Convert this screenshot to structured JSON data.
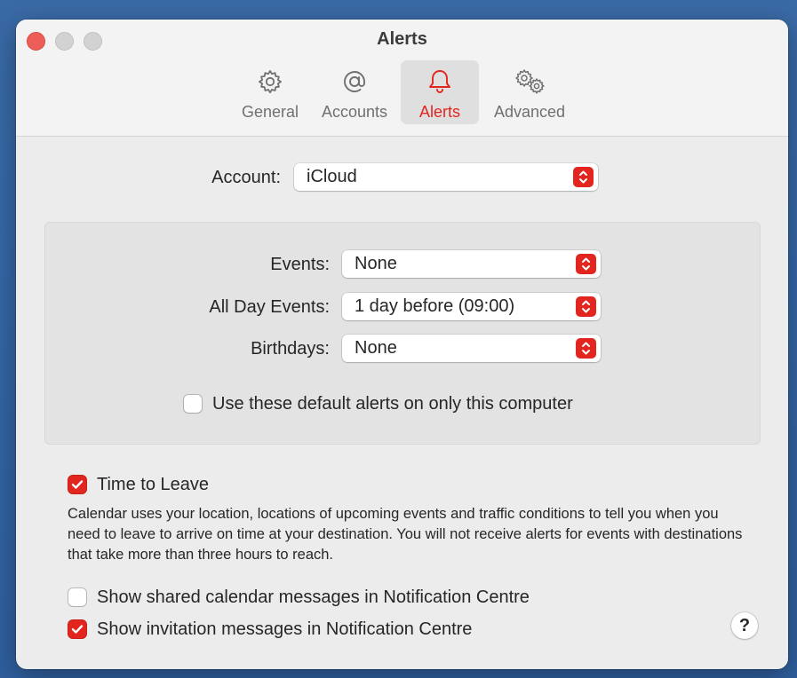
{
  "window": {
    "title": "Alerts"
  },
  "toolbar": {
    "tabs": [
      {
        "label": "General",
        "icon": "gear-icon"
      },
      {
        "label": "Accounts",
        "icon": "at-icon"
      },
      {
        "label": "Alerts",
        "icon": "bell-icon",
        "selected": true
      },
      {
        "label": "Advanced",
        "icon": "gears-icon"
      }
    ]
  },
  "account": {
    "label": "Account:",
    "value": "iCloud"
  },
  "defaults": {
    "events": {
      "label": "Events:",
      "value": "None"
    },
    "all_day_events": {
      "label": "All Day Events:",
      "value": "1 day before (09:00)"
    },
    "birthdays": {
      "label": "Birthdays:",
      "value": "None"
    },
    "only_this_computer": {
      "label": "Use these default alerts on only this computer",
      "checked": false
    }
  },
  "time_to_leave": {
    "label": "Time to Leave",
    "checked": true,
    "description": "Calendar uses your location, locations of upcoming events and traffic conditions to tell you when you need to leave to arrive on time at your destination. You will not receive alerts for events with destinations that take more than three hours to reach."
  },
  "shared_calendar_messages": {
    "label": "Show shared calendar messages in Notification Centre",
    "checked": false
  },
  "invitation_messages": {
    "label": "Show invitation messages in Notification Centre",
    "checked": true
  },
  "help": {
    "label": "?"
  },
  "colors": {
    "accent": "#e3251f",
    "close_button": "#ec5e57"
  }
}
